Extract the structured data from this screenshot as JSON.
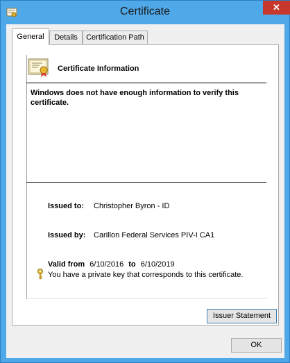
{
  "window": {
    "title": "Certificate"
  },
  "tabs": [
    {
      "label": "General"
    },
    {
      "label": "Details"
    },
    {
      "label": "Certification Path"
    }
  ],
  "general": {
    "heading": "Certificate Information",
    "warning": "Windows does not have enough information to verify this certificate.",
    "issued_to_label": "Issued to:",
    "issued_to_value": "Christopher Byron - ID",
    "issued_by_label": "Issued by:",
    "issued_by_value": "Carillon Federal Services PIV-I CA1",
    "valid_from_label": "Valid from",
    "valid_from_value": "6/10/2016",
    "valid_to_label": "to",
    "valid_to_value": "6/10/2019",
    "private_key_note": "You have a private key that corresponds to this certificate."
  },
  "buttons": {
    "issuer_statement": "Issuer Statement",
    "ok": "OK"
  }
}
